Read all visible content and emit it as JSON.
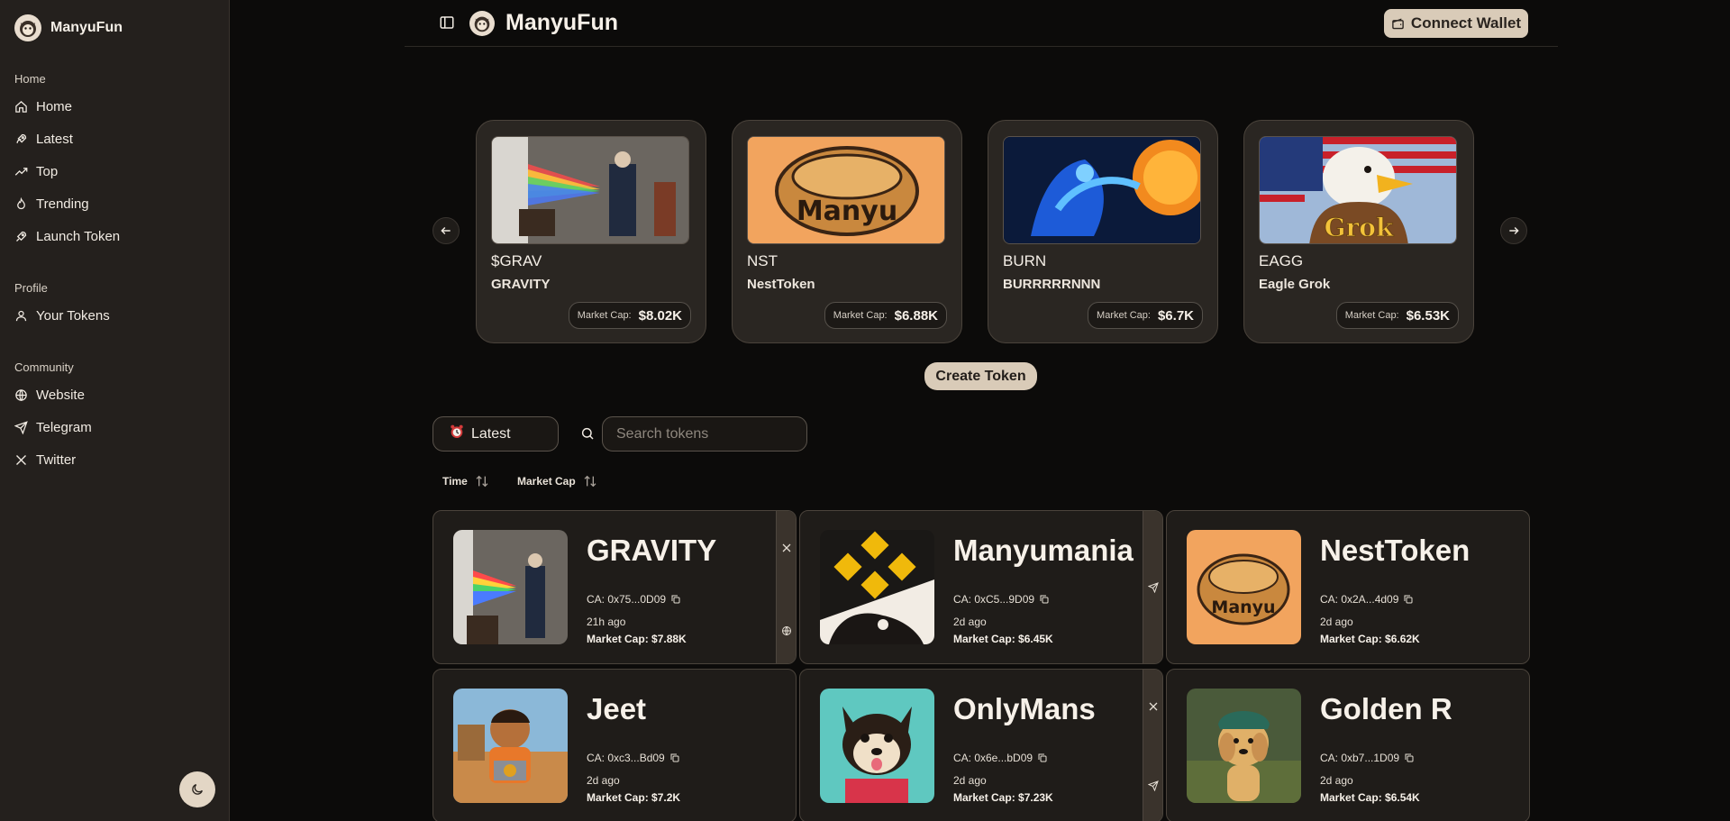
{
  "app": {
    "name": "ManyuFun"
  },
  "sidebar": {
    "sections": [
      {
        "label": "Home",
        "items": [
          {
            "label": "Home",
            "icon": "home-icon"
          },
          {
            "label": "Latest",
            "icon": "rocket-icon"
          },
          {
            "label": "Top",
            "icon": "trending-up-icon"
          },
          {
            "label": "Trending",
            "icon": "flame-icon"
          },
          {
            "label": "Launch Token",
            "icon": "rocket-icon"
          }
        ]
      },
      {
        "label": "Profile",
        "items": [
          {
            "label": "Your Tokens",
            "icon": "user-icon"
          }
        ]
      },
      {
        "label": "Community",
        "items": [
          {
            "label": "Website",
            "icon": "globe-icon"
          },
          {
            "label": "Telegram",
            "icon": "send-icon"
          },
          {
            "label": "Twitter",
            "icon": "x-logo-icon"
          }
        ]
      }
    ],
    "theme_toggle_icon": "moon-icon"
  },
  "header": {
    "title": "ManyuFun",
    "connect_label": "Connect Wallet"
  },
  "featured": [
    {
      "ticker": "$GRAV",
      "name": "GRAVITY",
      "mcap_label": "Market Cap:",
      "mcap": "$8.02K"
    },
    {
      "ticker": "NST",
      "name": "NestToken",
      "mcap_label": "Market Cap:",
      "mcap": "$6.88K"
    },
    {
      "ticker": "BURN",
      "name": "BURRRRRNNN",
      "mcap_label": "Market Cap:",
      "mcap": "$6.7K"
    },
    {
      "ticker": "EAGG",
      "name": "Eagle Grok",
      "mcap_label": "Market Cap:",
      "mcap": "$6.53K"
    }
  ],
  "featured_image_text": {
    "manyu": "Manyu",
    "grok": "Grok"
  },
  "create_label": "Create Token",
  "filter": {
    "selected": "Latest",
    "icon": "alarm-clock-icon"
  },
  "search": {
    "placeholder": "Search tokens"
  },
  "sort": {
    "time": "Time",
    "mcap": "Market Cap"
  },
  "tokens": [
    {
      "name": "GRAVITY",
      "ca": "CA: 0x75...0D09",
      "age": "21h ago",
      "mcap": "Market Cap: $7.88K"
    },
    {
      "name": "Manyumania",
      "ca": "CA: 0xC5...9D09",
      "age": "2d ago",
      "mcap": "Market Cap: $6.45K"
    },
    {
      "name": "NestToken",
      "ca": "CA: 0x2A...4d09",
      "age": "2d ago",
      "mcap": "Market Cap: $6.62K"
    },
    {
      "name": "Jeet",
      "ca": "CA: 0xc3...Bd09",
      "age": "2d ago",
      "mcap": "Market Cap: $7.2K"
    },
    {
      "name": "OnlyMans",
      "ca": "CA: 0x6e...bD09",
      "age": "2d ago",
      "mcap": "Market Cap: $7.23K"
    },
    {
      "name": "Golden R",
      "ca": "CA: 0xb7...1D09",
      "age": "2d ago",
      "mcap": "Market Cap: $6.54K"
    }
  ],
  "colors": {
    "bg": "#0c0b0a",
    "sidebar": "#24201d",
    "accent": "#d9cbb8",
    "card": "#2a2622"
  }
}
